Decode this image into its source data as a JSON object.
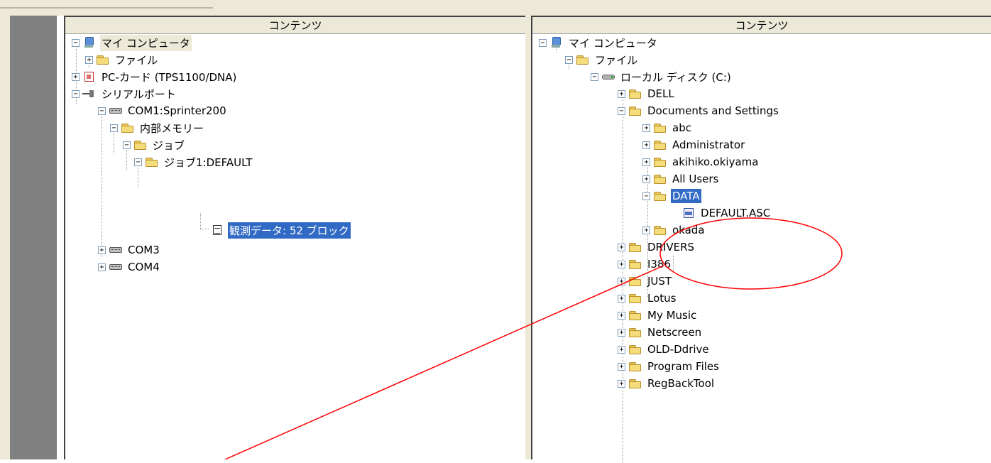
{
  "left_panel": {
    "header": "コンテンツ",
    "tree": {
      "my_computer": "マイ コンピュータ",
      "files": "ファイル",
      "pc_card": "PC-カード (TPS1100/DNA)",
      "serial_port": "シリアルポート",
      "com1": "COM1:Sprinter200",
      "internal_memory": "内部メモリー",
      "job": "ジョブ",
      "job1": "ジョブ1:DEFAULT",
      "observation_data": "観測データ: 52 ブロック",
      "com3": "COM3",
      "com4": "COM4"
    }
  },
  "right_panel": {
    "header": "コンテンツ",
    "tree": {
      "my_computer": "マイ コンピュータ",
      "files": "ファイル",
      "local_disk": "ローカル ディスク (C:)",
      "dell": "DELL",
      "documents_and_settings": "Documents and Settings",
      "abc": "abc",
      "administrator": "Administrator",
      "akihiko": "akihiko.okiyama",
      "all_users": "All Users",
      "data": "DATA",
      "default_asc": "DEFAULT.ASC",
      "okada": "okada",
      "drivers": "DRIVERS",
      "i386": "I386",
      "just": "JUST",
      "lotus": "Lotus",
      "my_music": "My Music",
      "netscreen": "Netscreen",
      "old_ddrive": "OLD-Ddrive",
      "program_files": "Program Files",
      "regbacktool": "RegBackTool"
    }
  },
  "annotation": {
    "color": "#ff0000"
  }
}
